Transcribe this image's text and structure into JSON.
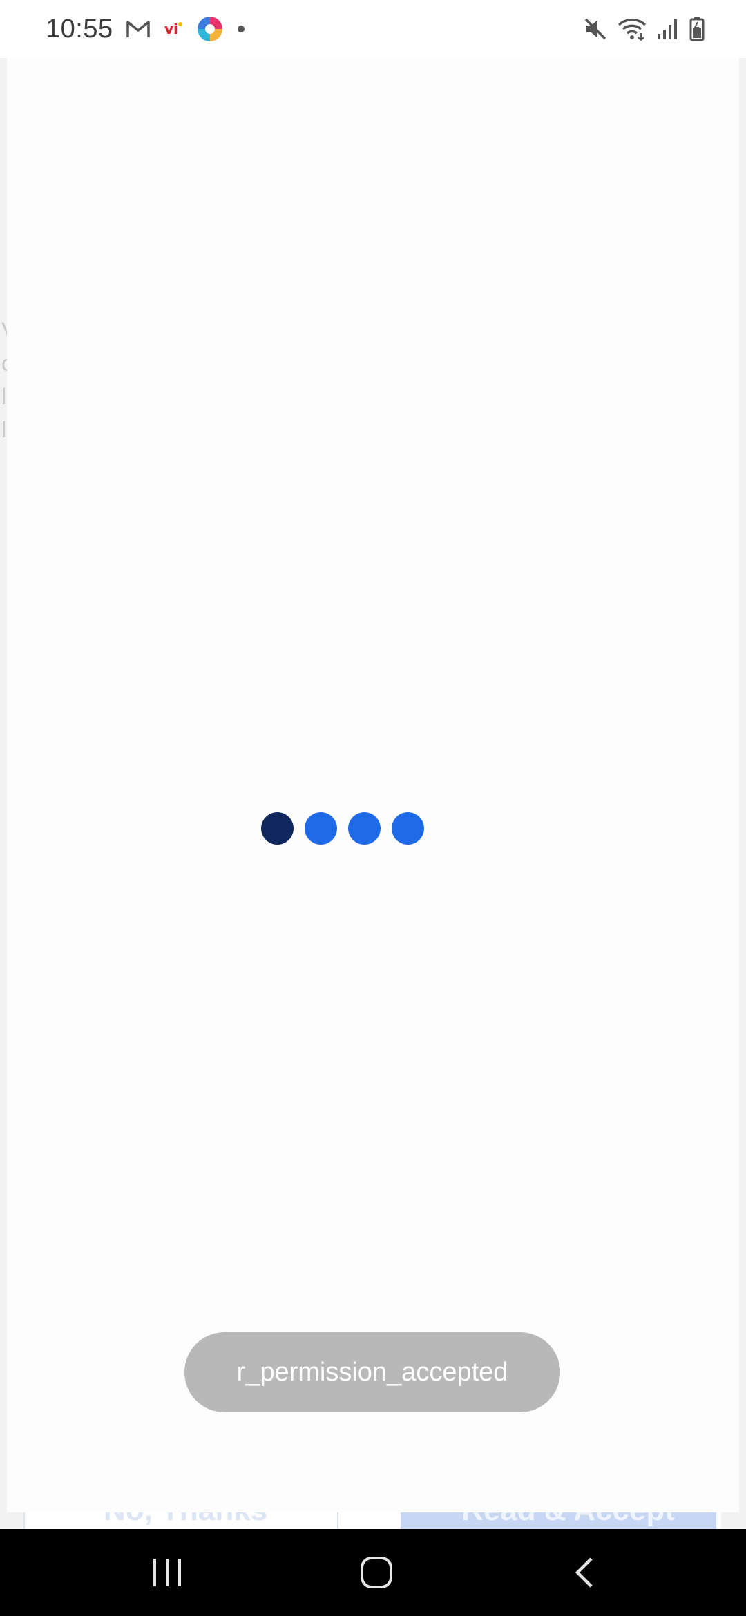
{
  "status_bar": {
    "time": "10:55",
    "left_icons": [
      "gmail-icon",
      "vi-icon",
      "app-icon",
      "dot-icon"
    ],
    "right_icons": [
      "mute-icon",
      "wifi-icon",
      "signal-icon",
      "battery-icon"
    ]
  },
  "background": {
    "faded_left_letters": [
      "V",
      "c",
      "l",
      "l"
    ],
    "no_thanks_label": "No, Thanks",
    "accept_label": "Read & Accept"
  },
  "loader": {
    "dot_colors": [
      "#10275e",
      "#1f6ae8",
      "#1f6ae8",
      "#1f6ae8"
    ]
  },
  "toast": {
    "message": "r_permission_accepted"
  },
  "nav_bar": {
    "buttons": [
      "recent-apps-icon",
      "home-icon",
      "back-icon"
    ]
  },
  "colors": {
    "accent_dark": "#10275e",
    "accent": "#1f6ae8",
    "toast_bg": "#b8b8b8"
  }
}
